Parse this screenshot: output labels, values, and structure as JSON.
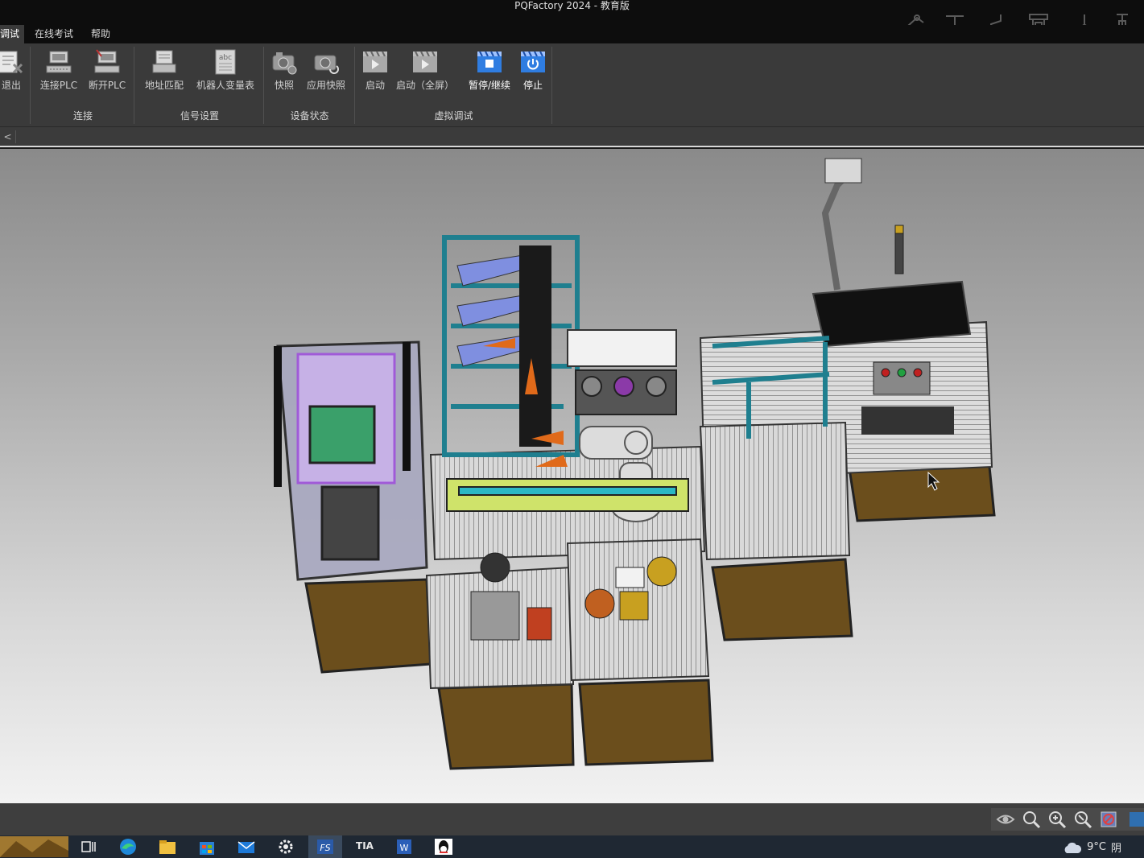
{
  "window": {
    "title": "PQFactory 2024 - 教育版"
  },
  "menu": {
    "items": [
      {
        "label": "调试",
        "active": true
      },
      {
        "label": "在线考试",
        "active": false
      },
      {
        "label": "帮助",
        "active": false
      }
    ]
  },
  "ribbon": {
    "buttons": {
      "exit": "退出",
      "connect_plc": "连接PLC",
      "disconnect_plc": "断开PLC",
      "address_match": "地址匹配",
      "robot_var_table": "机器人变量表",
      "snapshot": "快照",
      "apply_snapshot": "应用快照",
      "start": "启动",
      "start_fullscreen": "启动（全屏）",
      "pause_resume": "暂停/继续",
      "stop": "停止"
    },
    "groups": {
      "connect": "连接",
      "signal_settings": "信号设置",
      "device_state": "设备状态",
      "virtual_debug": "虚拟调试"
    }
  },
  "tabstrip": {
    "collapse_glyph": "<"
  },
  "viewport": {
    "description_icon": "3d-workcell-model"
  },
  "taskbar": {
    "weather_temp": "9°C",
    "weather_text": "阴",
    "apps": [
      "task-view-icon",
      "edge-icon",
      "file-explorer-icon",
      "store-icon",
      "mail-icon",
      "settings-icon",
      "pqfactory-icon",
      "tia-portal-icon",
      "word-icon",
      "qq-icon"
    ],
    "tia_label": "TIA"
  },
  "colors": {
    "titlebar_bg": "#0d0d0d",
    "ribbon_bg": "#3a3a3a",
    "accent_blue": "#2f7de1",
    "frame_teal": "#1f7f8f",
    "cabinet_brown": "#6b4e1c"
  }
}
